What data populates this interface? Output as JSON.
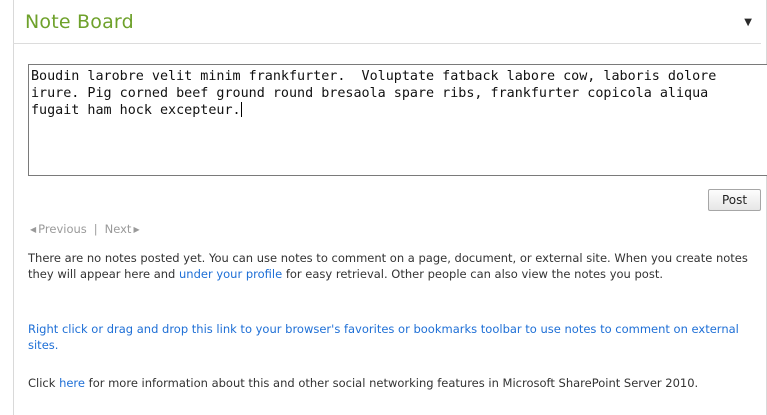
{
  "header": {
    "title": "Note Board"
  },
  "icons": {
    "menu": "dropdown-arrow-icon"
  },
  "composer": {
    "text": "Boudin larobre velit minim frankfurter.  Voluptate fatback labore cow, laboris dolore\nirure. Pig corned beef ground round bresaola spare ribs, frankfurter copicola aliqua\nfugait ham hock excepteur."
  },
  "actions": {
    "post_label": "Post"
  },
  "pager": {
    "previous": "Previous",
    "separator": "|",
    "next": "Next"
  },
  "info": {
    "p1_before": "There are no notes posted yet. You can use notes to comment on a page, document, or external site. When you create notes they will appear here and ",
    "p1_link": "under your profile",
    "p1_after": " for easy retrieval. Other people can also view the notes you post.",
    "p2_link": "Right click or drag and drop this link to your browser's favorites or bookmarks toolbar to use notes to comment on external sites.",
    "p3_before": "Click ",
    "p3_link": "here",
    "p3_after": " for more information about this and other social networking features in Microsoft SharePoint Server 2010."
  },
  "colors": {
    "title": "#6ea12b",
    "link": "#1e6fd6",
    "muted": "#9a9a9a"
  }
}
